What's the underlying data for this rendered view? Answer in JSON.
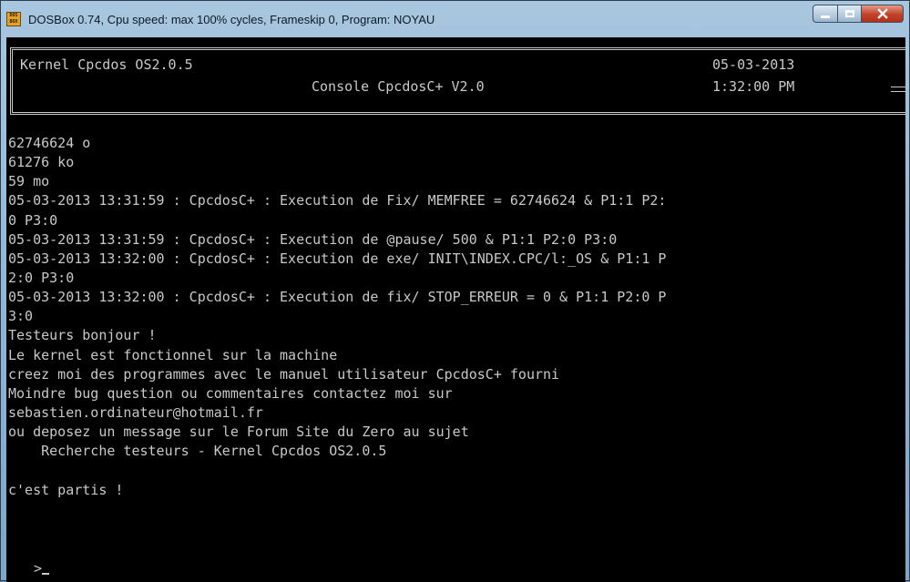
{
  "window": {
    "title": "DOSBox 0.74, Cpu speed: max 100% cycles, Frameskip  0, Program:    NOYAU",
    "app_icon_text": "DOS BOX",
    "controls": [
      "minimize-icon",
      "maximize-icon",
      "close-icon"
    ]
  },
  "header": {
    "kernel": "Kernel Cpcdos OS2.0.5",
    "console": "Console CpcdosC+ V2.0",
    "date": "05-03-2013",
    "time": "1:32:00 PM"
  },
  "lines": [
    "62746624 o",
    "61276 ko",
    "59 mo",
    "05-03-2013 13:31:59 : CpcdosC+ : Execution de Fix/ MEMFREE = 62746624 & P1:1 P2:",
    "0 P3:0",
    "05-03-2013 13:31:59 : CpcdosC+ : Execution de @pause/ 500 & P1:1 P2:0 P3:0",
    "05-03-2013 13:32:00 : CpcdosC+ : Execution de exe/ INIT\\INDEX.CPC/l:_OS & P1:1 P",
    "2:0 P3:0",
    "05-03-2013 13:32:00 : CpcdosC+ : Execution de fix/ STOP_ERREUR = 0 & P1:1 P2:0 P",
    "3:0",
    "Testeurs bonjour !",
    "Le kernel est fonctionnel sur la machine",
    "creez moi des programmes avec le manuel utilisateur CpcdosC+ fourni",
    "Moindre bug question ou commentaires contactez moi sur",
    "sebastien.ordinateur@hotmail.fr",
    "ou deposez un message sur le Forum Site du Zero au sujet",
    "    Recherche testeurs - Kernel Cpcdos OS2.0.5",
    "",
    "c'est partis !"
  ],
  "prompt": ">"
}
